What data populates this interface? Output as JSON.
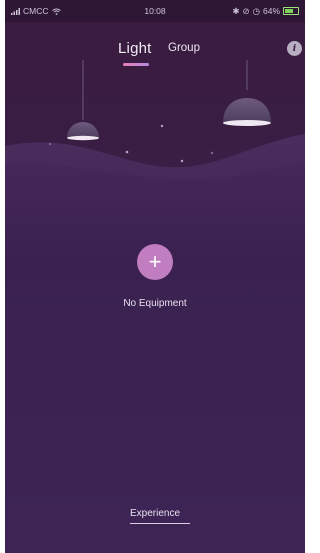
{
  "status_bar": {
    "carrier": "CMCC",
    "time": "10:08",
    "battery": "64%"
  },
  "tabs": {
    "light": "Light",
    "group": "Group",
    "active": "Light"
  },
  "info": {
    "icon": "info-icon",
    "label": "i"
  },
  "add": {
    "icon": "plus-icon",
    "symbol": "+"
  },
  "empty_state": {
    "label": "No Equipment"
  },
  "footer": {
    "experience": "Experience"
  },
  "colors": {
    "background_top": "#3a1c40",
    "background_bottom": "#3d2455",
    "accent": "#c07dc0",
    "indicator_start": "#ec7fb5",
    "indicator_end": "#b48be0"
  }
}
